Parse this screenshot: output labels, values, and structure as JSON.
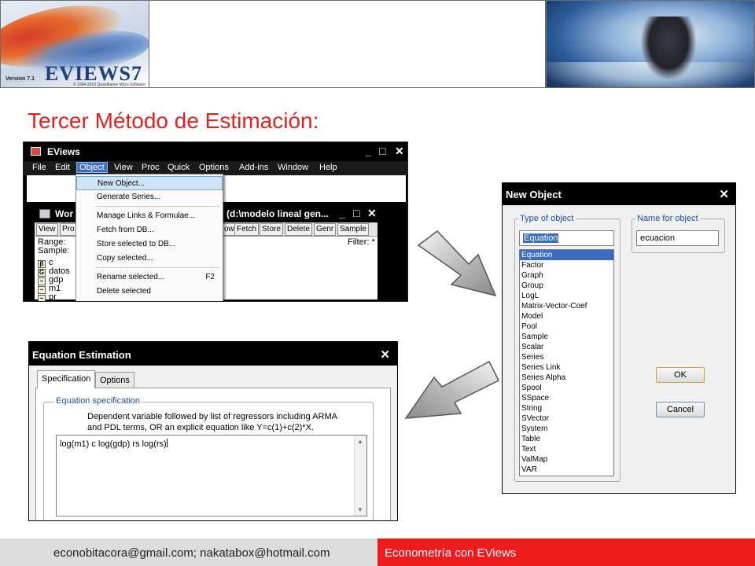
{
  "header": {
    "logo_brand": "EVIEWS7",
    "logo_version": "Version 7.1",
    "logo_copyright": "© 1994-2010 Quantitative Micro Software"
  },
  "title": "Tercer Método de Estimación:",
  "eviews_window": {
    "title": "EViews",
    "menus": [
      "File",
      "Edit",
      "Object",
      "View",
      "Proc",
      "Quick",
      "Options",
      "Add-ins",
      "Window",
      "Help"
    ],
    "active_menu": "Object",
    "workfile_title_left": "Wor",
    "workfile_title_right": "(d:\\modelo lineal gen...",
    "toolbar_left": [
      "View",
      "Pro"
    ],
    "toolbar_right": [
      "ow",
      "Fetch",
      "Store",
      "Delete",
      "Genr",
      "Sample"
    ],
    "range_label": "Range:",
    "sample_label": "Sample:",
    "filter_label": "Filter: *",
    "objects": [
      {
        "icon": "β",
        "name": "c"
      },
      {
        "icon": "G",
        "name": "datos"
      },
      {
        "icon": "~",
        "name": "gdp"
      },
      {
        "icon": "~",
        "name": "m1"
      },
      {
        "icon": "~",
        "name": "pr"
      }
    ],
    "object_menu": [
      {
        "label": "New Object...",
        "shortcut": ""
      },
      {
        "label": "Generate Series...",
        "shortcut": ""
      },
      {
        "label": "Manage Links & Formulae...",
        "shortcut": ""
      },
      {
        "label": "Fetch from DB...",
        "shortcut": ""
      },
      {
        "label": "Store selected to DB...",
        "shortcut": ""
      },
      {
        "label": "Copy selected...",
        "shortcut": ""
      },
      {
        "label": "Rename selected...",
        "shortcut": "F2"
      },
      {
        "label": "Delete selected",
        "shortcut": ""
      }
    ]
  },
  "new_object": {
    "title": "New Object",
    "type_group_label": "Type of object",
    "name_group_label": "Name for object",
    "type_value": "Equation",
    "name_value": "ecuacion",
    "types": [
      "Equation",
      "Factor",
      "Graph",
      "Group",
      "LogL",
      "Matrix-Vector-Coef",
      "Model",
      "Pool",
      "Sample",
      "Scalar",
      "Series",
      "Series Link",
      "Series Alpha",
      "Spool",
      "SSpace",
      "String",
      "SVector",
      "System",
      "Table",
      "Text",
      "ValMap",
      "VAR"
    ],
    "selected_type": "Equation",
    "ok_label": "OK",
    "cancel_label": "Cancel"
  },
  "equation_estimation": {
    "title": "Equation Estimation",
    "tabs": [
      "Specification",
      "Options"
    ],
    "active_tab": "Specification",
    "group_label": "Equation specification",
    "description_line1": "Dependent variable followed by list of regressors including ARMA",
    "description_line2": "and PDL terms, OR an explicit equation like Y=c(1)+c(2)*X.",
    "equation_text": "log(m1) c log(gdp) rs log(rs)"
  },
  "footer": {
    "emails": "econobitacora@gmail.com;  nakatabox@hotmail.com",
    "course": "Econometría con EViews"
  },
  "colors": {
    "title_red": "#e8201c",
    "footer_red": "#ee1c1c",
    "footer_gray": "#dcdcdc",
    "selection_blue": "#3a6cc6"
  }
}
